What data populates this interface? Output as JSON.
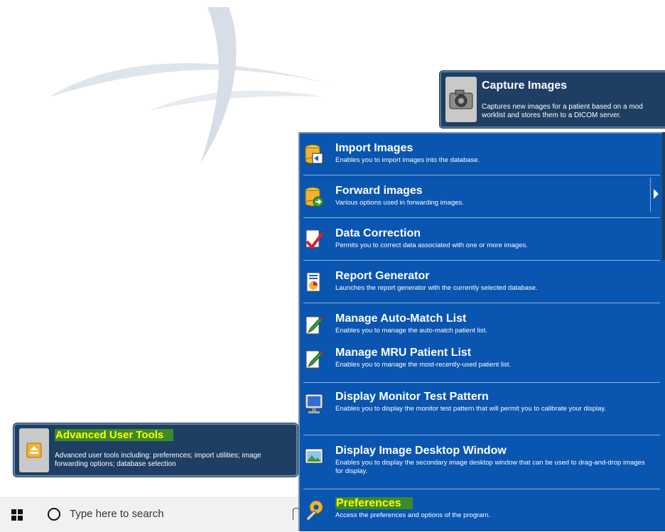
{
  "capture": {
    "title": "Capture Images",
    "description": "Captures new images for a patient based on a mod\nworklist and stores them to a DICOM server.",
    "icon": "camera-icon"
  },
  "advanced": {
    "title": "Advanced User Tools",
    "description": "Advanced user tools including: preferences; import utilities; image forwarding options; database selection",
    "icon": "folder-eject-icon"
  },
  "taskbar": {
    "search_placeholder": "Type here to search"
  },
  "menu": {
    "items": [
      {
        "title": "Import Images",
        "description": "Enables you to import images into the database.",
        "icon": "database-import-icon"
      },
      {
        "title": "Forward images",
        "description": "Various options used in forwarding images.",
        "icon": "database-forward-icon"
      },
      {
        "title": "Data Correction",
        "description": "Permits you to correct data associated with one or more images.",
        "icon": "document-check-icon"
      },
      {
        "title": "Report Generator",
        "description": "Launches the report generator with the currently selected database.",
        "icon": "report-chart-icon"
      },
      {
        "title": "Manage Auto-Match List",
        "description": "Enables you to manage the auto-match patient list.",
        "icon": "edit-pencil-icon"
      },
      {
        "title": "Manage MRU Patient List",
        "description": "Enables you to manage the most-recently-used patient list.",
        "icon": "edit-pencil-icon"
      },
      {
        "title": "Display Monitor Test Pattern",
        "description": "Enables you to display the monitor test pattern that will permit you to calibrate your display.",
        "icon": "monitor-icon"
      },
      {
        "title": "Display Image Desktop Window",
        "description": "Enables you to display the secondary image desktop window that can be used to drag-and-drop images for display.",
        "icon": "image-window-icon"
      },
      {
        "title": "Preferences",
        "description": "Access the preferences and options of the program.",
        "icon": "wrench-gear-icon"
      }
    ]
  }
}
